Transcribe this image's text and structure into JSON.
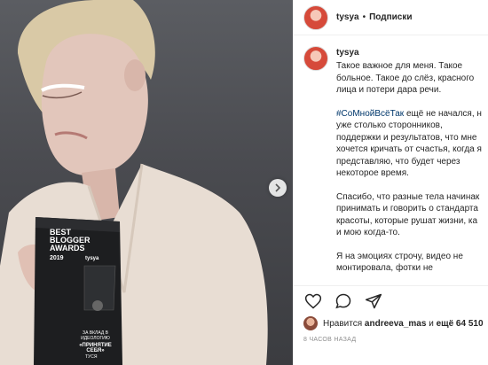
{
  "photo": {
    "trophy": {
      "title": "BEST BLOGGER AWARDS",
      "year": "2019",
      "brand": "tysya",
      "for_text": "ЗА ВКЛАД В ИДЕОЛОГИЮ",
      "category": "«ПРИНЯТИЕ СЕБЯ»",
      "recipient": "ТУСЯ"
    },
    "next_icon": "chevron-right-icon"
  },
  "header": {
    "username": "tysya",
    "separator": "•",
    "follow_label": "Подписки"
  },
  "caption": {
    "username": "tysya",
    "paragraphs": [
      [
        "Такое важное для меня. Такое",
        "больное. Такое до слёз, красного",
        "лица и потери дара речи."
      ],
      [
        "ещё не начался, н",
        "уже столько сторонников,",
        "поддержки и результатов, что мне",
        "хочется кричать от счастья, когда я",
        "представляю, что будет через",
        "некоторое время."
      ],
      [
        "Спасибо, что разные тела начинак",
        "принимать и говорить о стандарта",
        "красоты, которые рушат жизни, ка",
        "и мою когда-то."
      ],
      [
        "Я на эмоциях строчу, видео не",
        "монтировала, фотки не"
      ]
    ],
    "hashtag": "#СоМнойВсёТак"
  },
  "actions": {
    "icons": [
      "heart-icon",
      "comment-icon",
      "share-icon"
    ]
  },
  "likes": {
    "prefix": "Нравится",
    "user": "andreeva_mas",
    "middle": "и",
    "count": "ещё 64 510"
  },
  "time": "8 ЧАСОВ НАЗАД"
}
